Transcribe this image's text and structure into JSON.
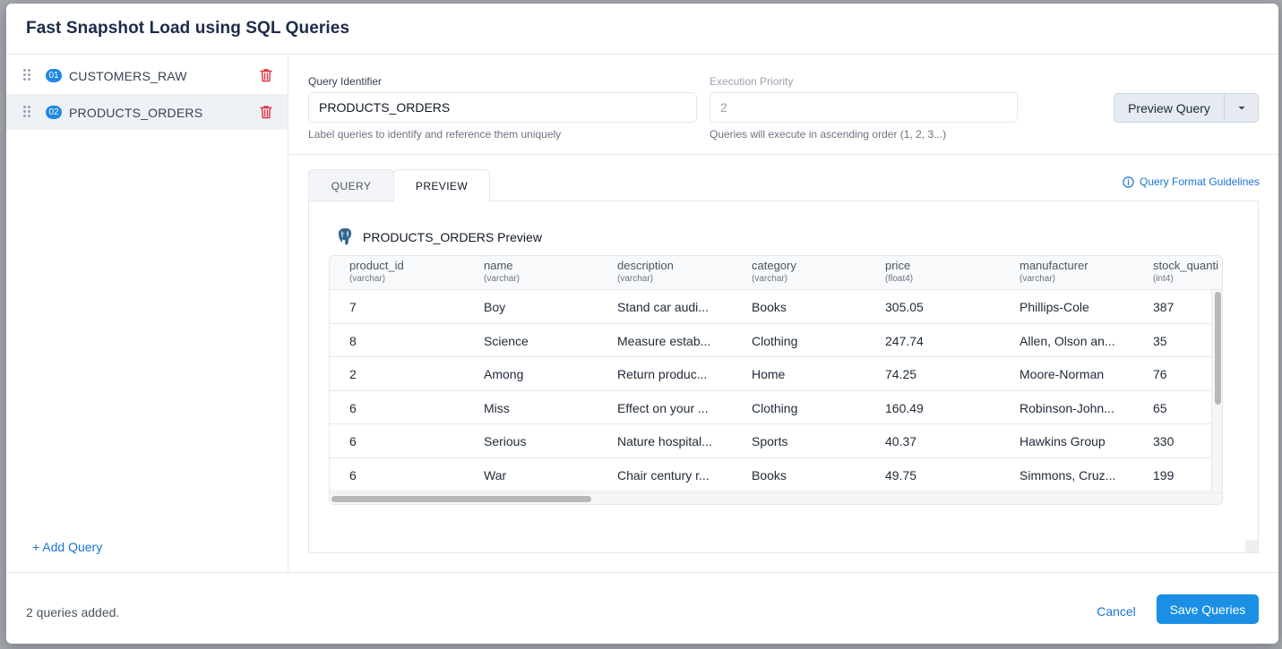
{
  "modal": {
    "title": "Fast Snapshot Load using SQL Queries"
  },
  "sidebar": {
    "items": [
      {
        "index": "01",
        "name": "CUSTOMERS_RAW",
        "active": false
      },
      {
        "index": "02",
        "name": "PRODUCTS_ORDERS",
        "active": true
      }
    ],
    "add_label": "+ Add Query"
  },
  "form": {
    "identifier": {
      "label": "Query Identifier",
      "value": "PRODUCTS_ORDERS",
      "help": "Label queries to identify and reference them uniquely"
    },
    "priority": {
      "label": "Execution Priority",
      "value": "2",
      "help": "Queries will execute in ascending order (1, 2, 3...)"
    },
    "preview_button": "Preview Query"
  },
  "tabs": [
    {
      "label": "QUERY",
      "active": false
    },
    {
      "label": "PREVIEW",
      "active": true
    }
  ],
  "guidelines_link": "Query Format Guidelines",
  "preview": {
    "title": "PRODUCTS_ORDERS Preview",
    "columns": [
      {
        "name": "product_id",
        "type": "(varchar)"
      },
      {
        "name": "name",
        "type": "(varchar)"
      },
      {
        "name": "description",
        "type": "(varchar)"
      },
      {
        "name": "category",
        "type": "(varchar)"
      },
      {
        "name": "price",
        "type": "(float4)"
      },
      {
        "name": "manufacturer",
        "type": "(varchar)"
      },
      {
        "name": "stock_quanti",
        "type": "(int4)"
      }
    ],
    "rows": [
      [
        "7",
        "Boy",
        "Stand car audi...",
        "Books",
        "305.05",
        "Phillips-Cole",
        "387"
      ],
      [
        "8",
        "Science",
        "Measure estab...",
        "Clothing",
        "247.74",
        "Allen, Olson an...",
        "35"
      ],
      [
        "2",
        "Among",
        "Return produc...",
        "Home",
        "74.25",
        "Moore-Norman",
        "76"
      ],
      [
        "6",
        "Miss",
        "Effect on your ...",
        "Clothing",
        "160.49",
        "Robinson-John...",
        "65"
      ],
      [
        "6",
        "Serious",
        "Nature hospital...",
        "Sports",
        "40.37",
        "Hawkins Group",
        "330"
      ],
      [
        "6",
        "War",
        "Chair century r...",
        "Books",
        "49.75",
        "Simmons, Cruz...",
        "199"
      ]
    ]
  },
  "footer": {
    "status": "2 queries added.",
    "cancel": "Cancel",
    "save": "Save Queries"
  },
  "colors": {
    "accent": "#1a8fe3",
    "link": "#1a73d6",
    "danger": "#e0323c"
  }
}
